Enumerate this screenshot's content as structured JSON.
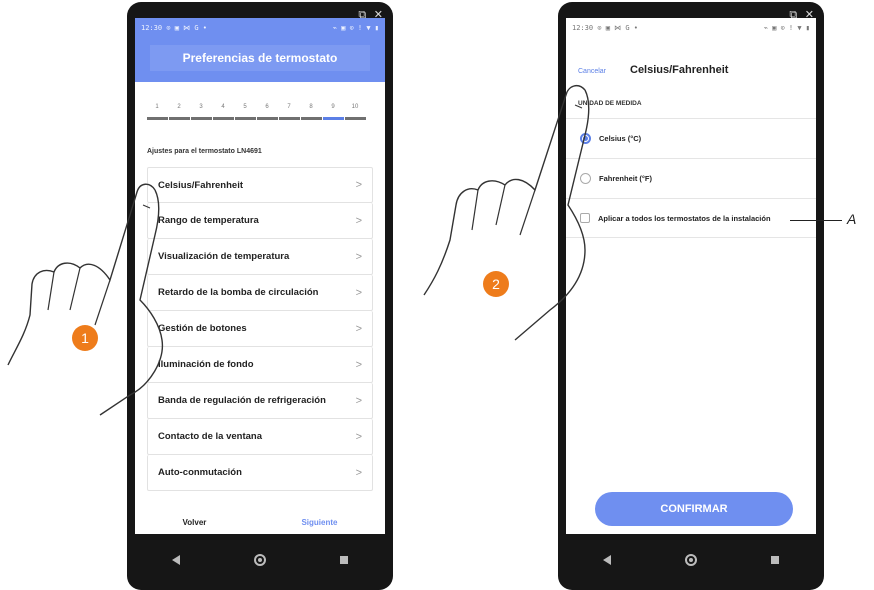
{
  "phone1": {
    "status_left": "12:30 ⊙ ▣ ⋈ G •",
    "status_right": "⌁ ▣ ⊙ ! ▼ ▮",
    "header_title": "Preferencias de termostato",
    "steps": [
      "1",
      "2",
      "3",
      "4",
      "5",
      "6",
      "7",
      "8",
      "9",
      "10"
    ],
    "active_step": 9,
    "section_title": "Ajustes para el termostato LN4691",
    "items": [
      {
        "label": "Celsius/Fahrenheit"
      },
      {
        "label": "Rango de temperatura"
      },
      {
        "label": "Visualización de temperatura"
      },
      {
        "label": "Retardo de la bomba de circulación"
      },
      {
        "label": "Gestión de botones"
      },
      {
        "label": "Iluminación de fondo"
      },
      {
        "label": "Banda de regulación de refrigeración"
      },
      {
        "label": "Contacto de la ventana"
      },
      {
        "label": "Auto-conmutación"
      }
    ],
    "back_label": "Volver",
    "next_label": "Siguiente"
  },
  "phone2": {
    "status_left": "12:30 ⊙ ▣ ⋈ G •",
    "status_right": "⌁ ▣ ⊙ ! ▼ ▮",
    "cancel_label": "Cancelar",
    "title": "Celsius/Fahrenheit",
    "section_title": "UNIDAD DE MEDIDA",
    "option_celsius": "Celsius (°C)",
    "option_fahrenheit": "Fahrenheit (°F)",
    "apply_all": "Aplicar a todos los termostatos de la instalación",
    "confirm_label": "CONFIRMAR"
  },
  "corner_icons": "⧉ ✕",
  "badge1": "1",
  "badge2": "2",
  "callout": "A",
  "colors": {
    "accent": "#6f8ff0",
    "badge": "#ee7c1b"
  }
}
